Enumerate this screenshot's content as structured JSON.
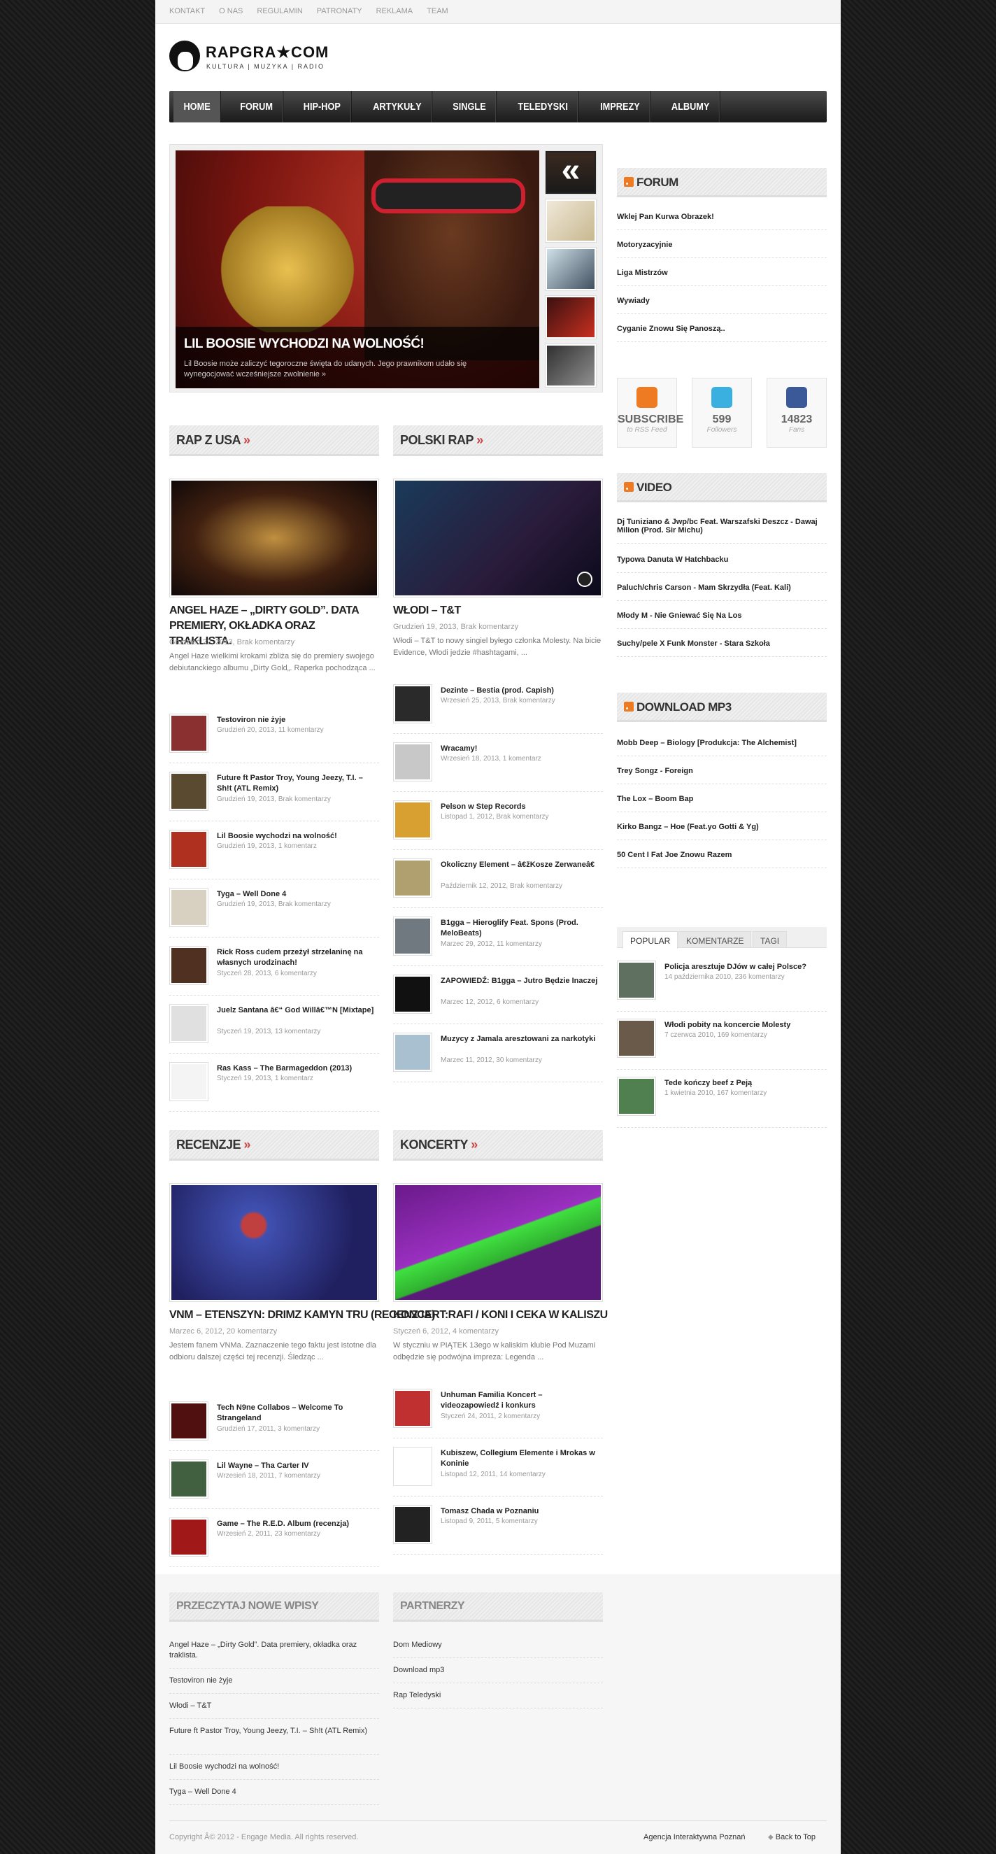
{
  "topnav": [
    "Kontakt",
    "O nas",
    "Regulamin",
    "Patronaty",
    "Reklama",
    "Team"
  ],
  "logo": {
    "title": "RAPGRA★COM",
    "subtitle": "KULTURA | MUZYKA | RADIO"
  },
  "mainnav": [
    "Home",
    "Forum",
    "Hip-Hop",
    "Artykuły",
    "Single",
    "Teledyski",
    "Imprezy",
    "Albumy"
  ],
  "slider": {
    "title": "LIL BOOSIE WYCHODZI NA WOLNOŚĆ!",
    "text": "Lil Boosie może zaliczyć tegoroczne święta do udanych. Jego prawnikom udało się wynegocjować wcześniejsze zwolnienie",
    "more": "»",
    "prev": "«"
  },
  "rapusa": {
    "heading": "RAP Z USA",
    "arrow": "»",
    "title": "ANGEL HAZE – „DIRTY GOLD”. DATA PREMIERY, OKŁADKA ORAZ TRAKLISTA.",
    "meta": "Grudzień 22, 2013, Brak komentarzy",
    "excerpt": "Angel Haze wielkimi krokami zbliża się do premiery swojego debiutanckiego albumu „Dirty Gold„. Raperka pochodząca ...",
    "items": [
      {
        "title": "Testoviron nie żyje",
        "meta": "Grudzień 20, 2013, 11 komentarzy",
        "color": "#8a3030"
      },
      {
        "title": "Future ft Pastor Troy, Young Jeezy, T.I. – Sh!t (ATL Remix)",
        "meta": "Grudzień 19, 2013, Brak komentarzy",
        "color": "#5a4a30"
      },
      {
        "title": "Lil Boosie wychodzi na wolność!",
        "meta": "Grudzień 19, 2013, 1 komentarz",
        "color": "#b03020"
      },
      {
        "title": "Tyga – Well Done 4",
        "meta": "Grudzień 19, 2013, Brak komentarzy",
        "color": "#d8d0c0"
      },
      {
        "title": "Rick Ross cudem przeżył strzelaninę na własnych urodzinach!",
        "meta": "Styczeń 28, 2013, 6 komentarzy",
        "color": "#503020"
      },
      {
        "title": "Juelz Santana â€“ God Willâ€™N [Mixtape]",
        "meta": "Styczeń 19, 2013, 13 komentarzy",
        "color": "#e0e0e0"
      },
      {
        "title": "Ras Kass – The Barmageddon (2013)",
        "meta": "Styczeń 19, 2013, 1 komentarz",
        "color": "#f4f4f4"
      }
    ]
  },
  "polskirap": {
    "heading": "POLSKI RAP",
    "arrow": "»",
    "title": "WŁODI – T&T",
    "meta": "Grudzień 19, 2013, Brak komentarzy",
    "excerpt": "Włodi – T&T to nowy singiel byłego członka Molesty. Na bicie Evidence, Włodi jedzie #hashtagami, ...",
    "items": [
      {
        "title": "Dezinte – Bestia (prod. Capish)",
        "meta": "Wrzesień 25, 2013, Brak komentarzy",
        "color": "#2a2a2a"
      },
      {
        "title": "Wracamy!",
        "meta": "Wrzesień 18, 2013, 1 komentarz",
        "color": "#c8c8c8"
      },
      {
        "title": "Pelson w Step Records",
        "meta": "Listopad 1, 2012, Brak komentarzy",
        "color": "#d8a030"
      },
      {
        "title": "Okoliczny Element – â€žKosze Zerwaneâ€",
        "meta": "Październik 12, 2012, Brak komentarzy",
        "color": "#b0a070"
      },
      {
        "title": "B1gga – Hieroglify Feat. Spons (Prod. MeloBeats)",
        "meta": "Marzec 29, 2012, 11 komentarzy",
        "color": "#707880"
      },
      {
        "title": "ZAPOWIEDŹ: B1gga – Jutro Będzie Inaczej",
        "meta": "Marzec 12, 2012, 6 komentarzy",
        "color": "#111111"
      },
      {
        "title": "Muzycy z Jamala aresztowani za narkotyki",
        "meta": "Marzec 11, 2012, 30 komentarzy",
        "color": "#a8c0d0"
      }
    ]
  },
  "recenzje": {
    "heading": "RECENZJE",
    "arrow": "»",
    "title": "VNM – ETENSZYN: DRIMZ KAMYN TRU (RECENZJA)",
    "meta": "Marzec 6, 2012, 20 komentarzy",
    "excerpt": "Jestem fanem VNMa. Zaznaczenie tego faktu jest istotne dla odbioru dalszej części tej recenzji. Śledząc ...",
    "items": [
      {
        "title": "Tech N9ne Collabos – Welcome To Strangeland",
        "meta": "Grudzień 17, 2011, 3 komentarzy",
        "color": "#501010"
      },
      {
        "title": "Lil Wayne – Tha Carter IV",
        "meta": "Wrzesień 18, 2011, 7 komentarzy",
        "color": "#406040"
      },
      {
        "title": "Game – The R.E.D. Album (recenzja)",
        "meta": "Wrzesień 2, 2011, 23 komentarzy",
        "color": "#a01818"
      }
    ]
  },
  "koncerty": {
    "heading": "KONCERTY",
    "arrow": "»",
    "title": "KONCERT:RAFI / KONI I CEKA W KALISZU",
    "meta": "Styczeń 6, 2012, 4 komentarzy",
    "excerpt": "W styczniu w PIĄTEK 13ego w kaliskim klubie Pod Muzami odbędzie się podwójna impreza: Legenda ...",
    "items": [
      {
        "title": "Unhuman Familia Koncert – videozapowiedź i konkurs",
        "meta": "Styczeń 24, 2011, 2 komentarzy",
        "color": "#c03030"
      },
      {
        "title": "Kubiszew, Collegium Elemente i Mrokas w Koninie",
        "meta": "Listopad 12, 2011, 14 komentarzy",
        "color": "#ffffff"
      },
      {
        "title": "Tomasz Chada w Poznaniu",
        "meta": "Listopad 9, 2011, 5 komentarzy",
        "color": "#222222"
      }
    ]
  },
  "forum": {
    "heading": "FORUM",
    "links": [
      "Wklej Pan Kurwa Obrazek!",
      "Motoryzacyjnie",
      "Liga Mistrzów",
      "Wywiady",
      "Cyganie Znowu Się Panoszą.."
    ]
  },
  "social": [
    {
      "label": "SUBSCRIBE",
      "sub": "to RSS Feed",
      "color": "#ee7a22"
    },
    {
      "label": "599",
      "sub": "Followers",
      "color": "#3ab0e0"
    },
    {
      "label": "14823",
      "sub": "Fans",
      "color": "#3b5998"
    }
  ],
  "video": {
    "heading": "VIDEO",
    "links": [
      "Dj Tuniziano & Jwp/bc Feat. Warszafski Deszcz - Dawaj Milion (Prod. Sir Michu)",
      "Typowa Danuta W Hatchbacku",
      "Paluch/chris Carson - Mam Skrzydła (Feat. Kali)",
      "Młody M - Nie Gniewać Się Na Los",
      "Suchy/pele X Funk Monster - Stara Szkoła"
    ]
  },
  "download": {
    "heading": "DOWNLOAD MP3",
    "links": [
      "Mobb Deep – Biology [Produkcja: The Alchemist]",
      "Trey Songz - Foreign",
      "The Lox – Boom Bap",
      "Kirko Bangz – Hoe (Feat.yo Gotti & Yg)",
      "50 Cent I Fat Joe Znowu Razem"
    ]
  },
  "tabs": {
    "labels": [
      "POPULAR",
      "KOMENTARZE",
      "TAGI"
    ],
    "items": [
      {
        "title": "Policja aresztuje DJów w całej Polsce?",
        "meta": "14 października 2010, 236 komentarzy",
        "color": "#607060"
      },
      {
        "title": "Włodi pobity na koncercie Molesty",
        "meta": "7 czerwca 2010, 169 komentarzy",
        "color": "#6a5a4a"
      },
      {
        "title": "Tede kończy beef z Peją",
        "meta": "1 kwietnia 2010, 167 komentarzy",
        "color": "#508050"
      }
    ]
  },
  "footer": {
    "newposts_heading": "PRZECZYTAJ NOWE WPISY",
    "newposts": [
      "Angel Haze – „Dirty Gold”. Data premiery, okładka oraz traklista.",
      "Testoviron nie żyje",
      "Włodi – T&T",
      "Future ft Pastor Troy, Young Jeezy, T.I. – Sh!t (ATL Remix)",
      "Lil Boosie wychodzi na wolność!",
      "Tyga – Well Done 4"
    ],
    "partners_heading": "PARTNERZY",
    "partners": [
      "Dom Mediowy",
      "Download mp3",
      "Rap Teledyski"
    ],
    "copyright": "Copyright Â© 2012 - Engage Media. All rights reserved.",
    "agency": "Agencja Interaktywna Poznań",
    "backtotop": "Back to Top"
  }
}
